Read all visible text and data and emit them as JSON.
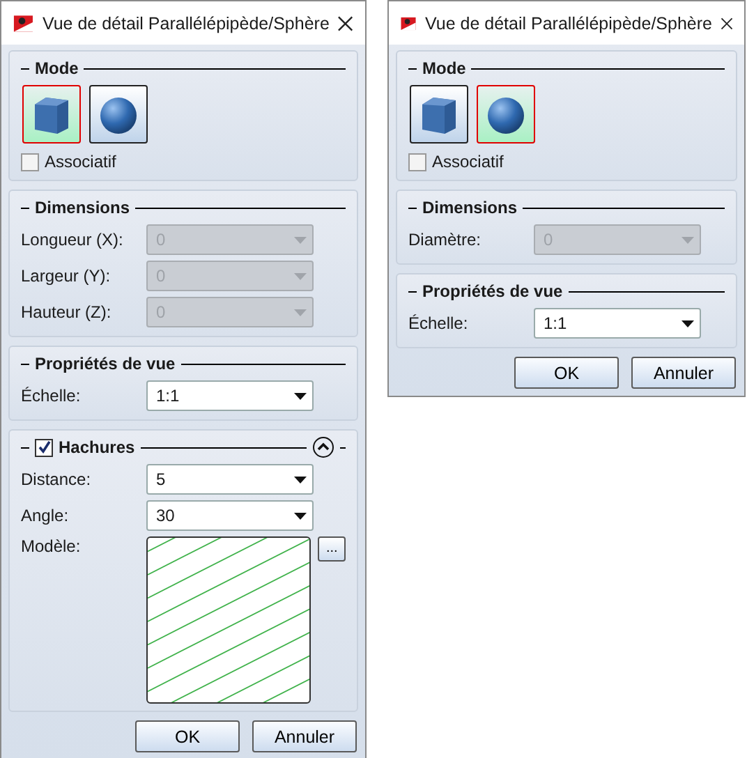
{
  "dialogs": [
    {
      "title": "Vue de détail Parallélépipède/Sphère",
      "sections": [
        {
          "kind": "mode",
          "heading": "Mode",
          "modes": [
            {
              "kind": "box",
              "selected": true
            },
            {
              "kind": "sphere",
              "selected": false
            }
          ],
          "option": {
            "label": "Associatif",
            "checked": false
          }
        },
        {
          "kind": "fields",
          "heading": "Dimensions",
          "fields": [
            {
              "label": "Longueur (X):",
              "value": "0",
              "disabled": true
            },
            {
              "label": "Largeur (Y):",
              "value": "0",
              "disabled": true
            },
            {
              "label": "Hauteur (Z):",
              "value": "0",
              "disabled": true
            }
          ]
        },
        {
          "kind": "fields",
          "heading": "Propriétés de vue",
          "fields": [
            {
              "label": "Échelle:",
              "value": "1:1",
              "disabled": false
            }
          ]
        },
        {
          "kind": "hatch",
          "heading": "Hachures",
          "checked": true,
          "expanded": true,
          "fields": [
            {
              "label": "Distance:",
              "value": "5",
              "disabled": false
            },
            {
              "label": "Angle:",
              "value": "30",
              "disabled": false
            }
          ],
          "pattern_label": "Modèle:",
          "browse": "..."
        }
      ],
      "buttons": [
        "OK",
        "Annuler"
      ]
    },
    {
      "title": "Vue de détail Parallélépipède/Sphère",
      "sections": [
        {
          "kind": "mode",
          "heading": "Mode",
          "modes": [
            {
              "kind": "box",
              "selected": false
            },
            {
              "kind": "sphere",
              "selected": true
            }
          ],
          "option": {
            "label": "Associatif",
            "checked": false
          }
        },
        {
          "kind": "fields",
          "heading": "Dimensions",
          "fields": [
            {
              "label": "Diamètre:",
              "value": "0",
              "disabled": true
            }
          ]
        },
        {
          "kind": "fields",
          "heading": "Propriétés de vue",
          "fields": [
            {
              "label": "Échelle:",
              "value": "1:1",
              "disabled": false
            }
          ]
        }
      ],
      "buttons": [
        "OK",
        "Annuler"
      ]
    }
  ]
}
